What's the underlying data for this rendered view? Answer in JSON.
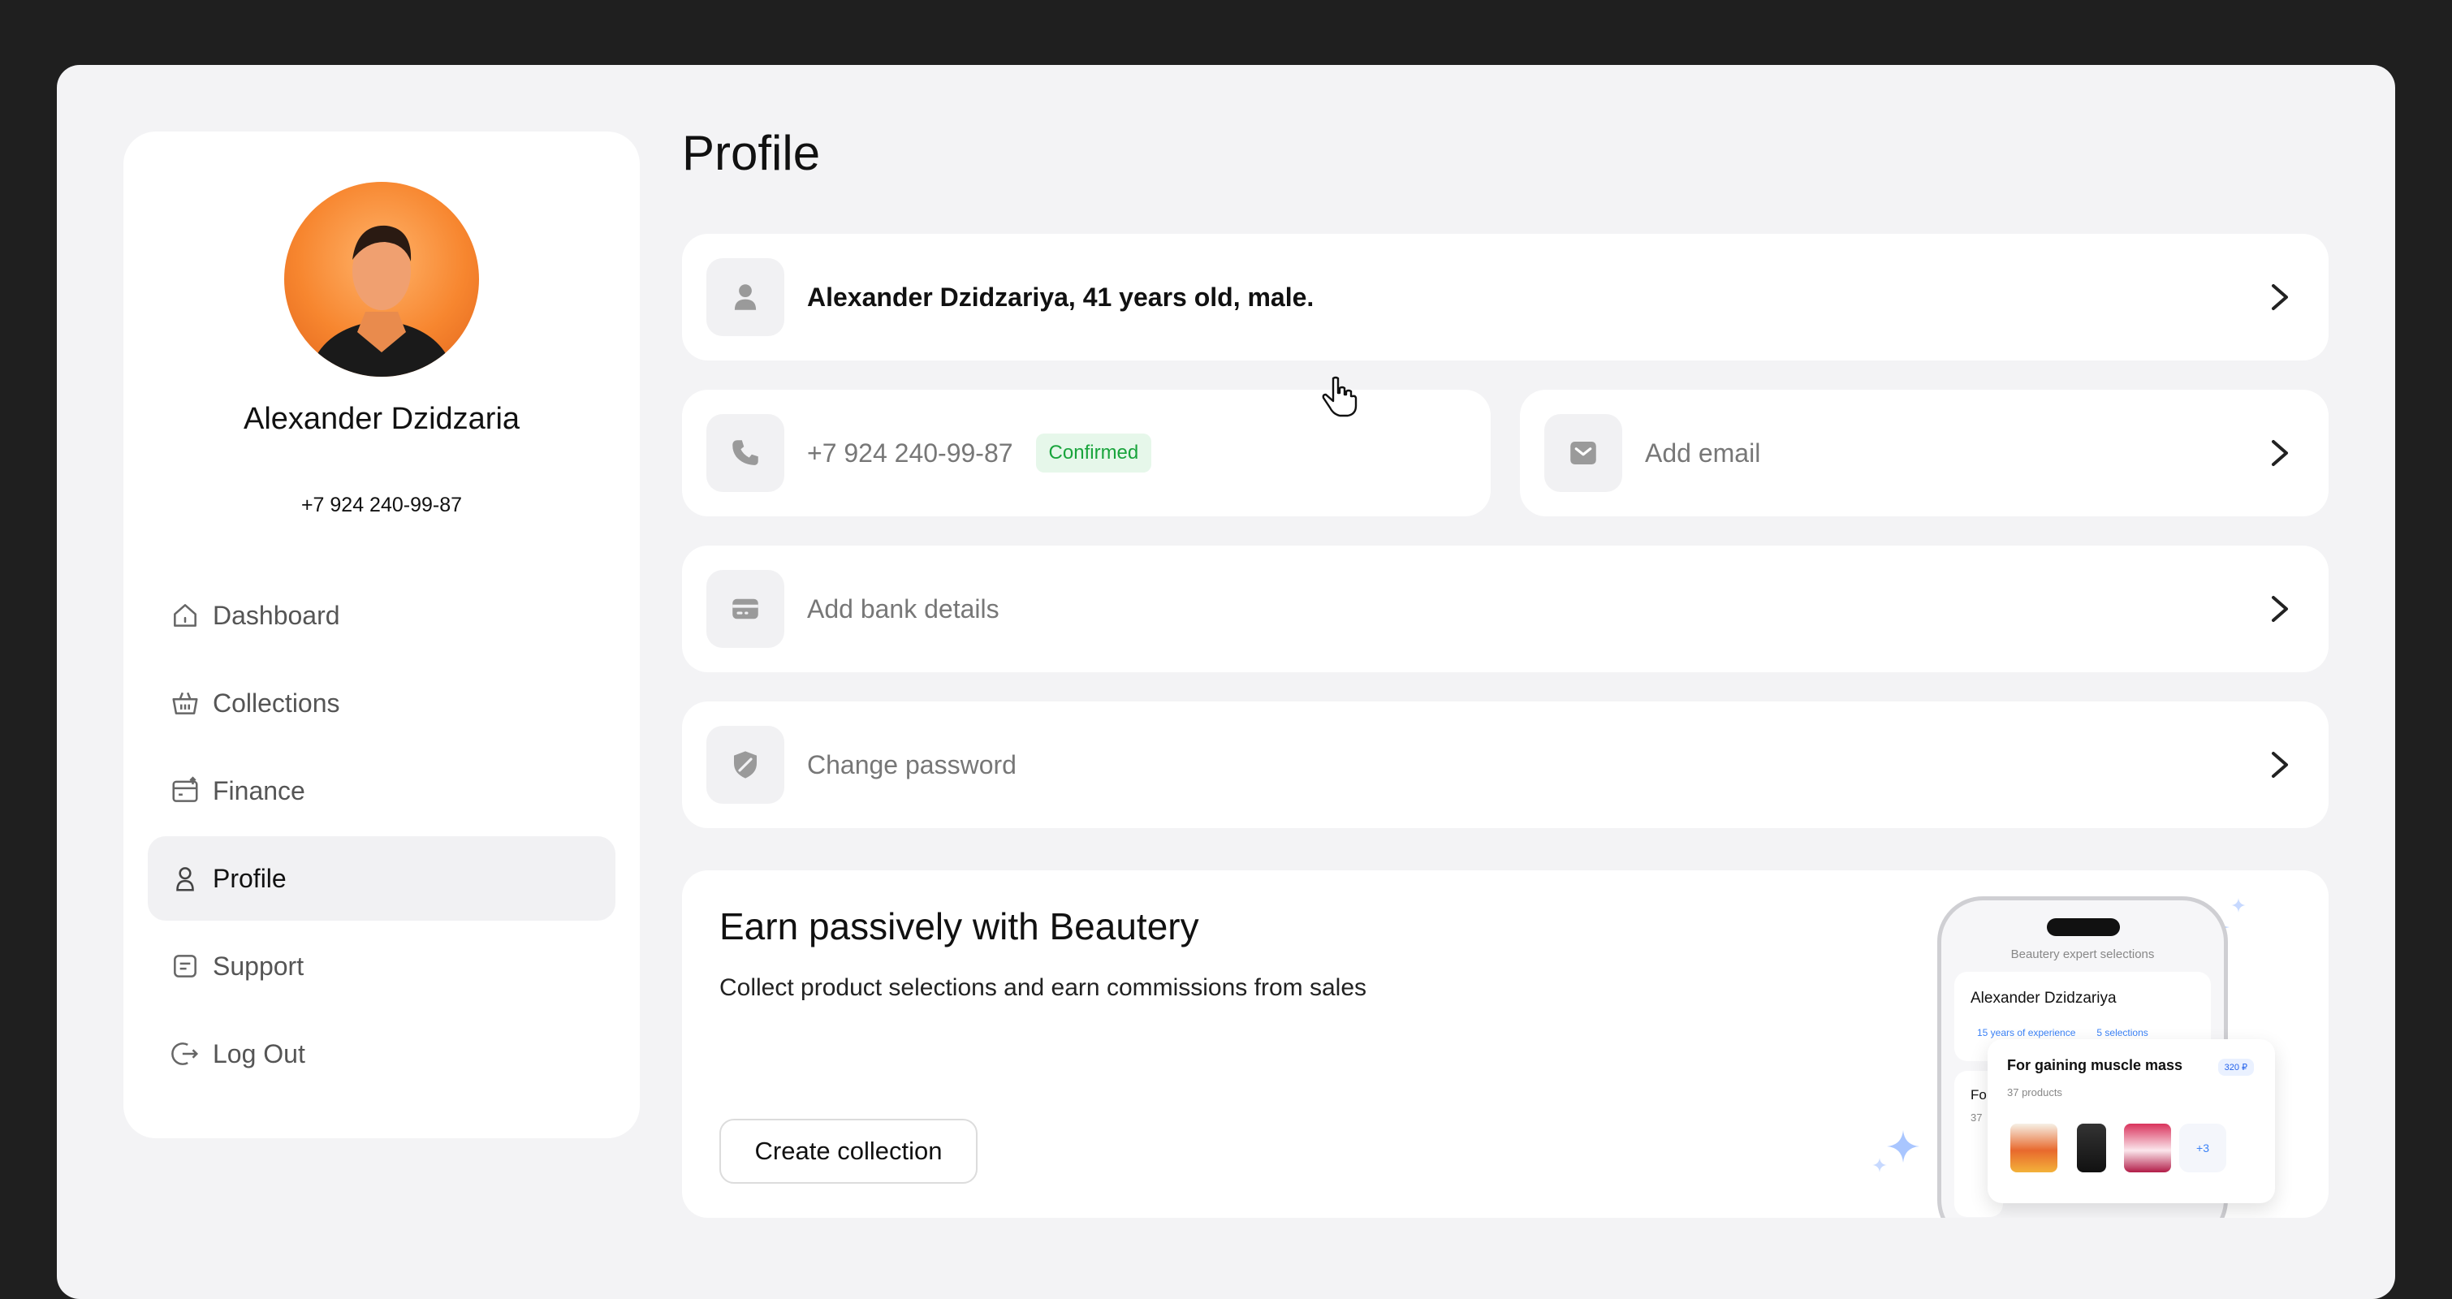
{
  "sidebar": {
    "user": {
      "name": "Alexander Dzidzaria",
      "phone": "+7 924 240-99-87"
    },
    "nav": [
      {
        "label": "Dashboard",
        "icon": "home-icon",
        "active": false
      },
      {
        "label": "Collections",
        "icon": "basket-icon",
        "active": false
      },
      {
        "label": "Finance",
        "icon": "finance-icon",
        "active": false
      },
      {
        "label": "Profile",
        "icon": "user-icon",
        "active": true
      },
      {
        "label": "Support",
        "icon": "support-icon",
        "active": false
      },
      {
        "label": "Log Out",
        "icon": "logout-icon",
        "active": false
      }
    ]
  },
  "main": {
    "title": "Profile",
    "personal": {
      "text": "Alexander Dzidzariya, 41 years old, male.",
      "icon": "user-icon"
    },
    "phone": {
      "value": "+7 924 240-99-87",
      "badge": "Confirmed",
      "icon": "phone-icon"
    },
    "email": {
      "label": "Add email",
      "icon": "mail-icon"
    },
    "bank": {
      "label": "Add bank details",
      "icon": "card-icon"
    },
    "password": {
      "label": "Change password",
      "icon": "shield-icon"
    },
    "promo": {
      "title": "Earn passively with Beautery",
      "subtitle": "Collect product selections and earn commissions from sales",
      "button": "Create collection",
      "illustration": {
        "caption": "Beautery expert selections",
        "expert_name": "Alexander Dzidzariya",
        "tag_experience": "15 years of experience",
        "tag_selections": "5 selections",
        "card_title": "For gaining muscle mass",
        "card_products": "37 products",
        "card_price": "320 ₽",
        "more": "+3",
        "partial_title": "For",
        "partial_sub": "37"
      }
    }
  },
  "colors": {
    "accent_green": "#19a43c",
    "accent_blue": "#3b82f6",
    "page_bg": "#f3f3f5",
    "frame_bg": "#1f1f1f"
  }
}
